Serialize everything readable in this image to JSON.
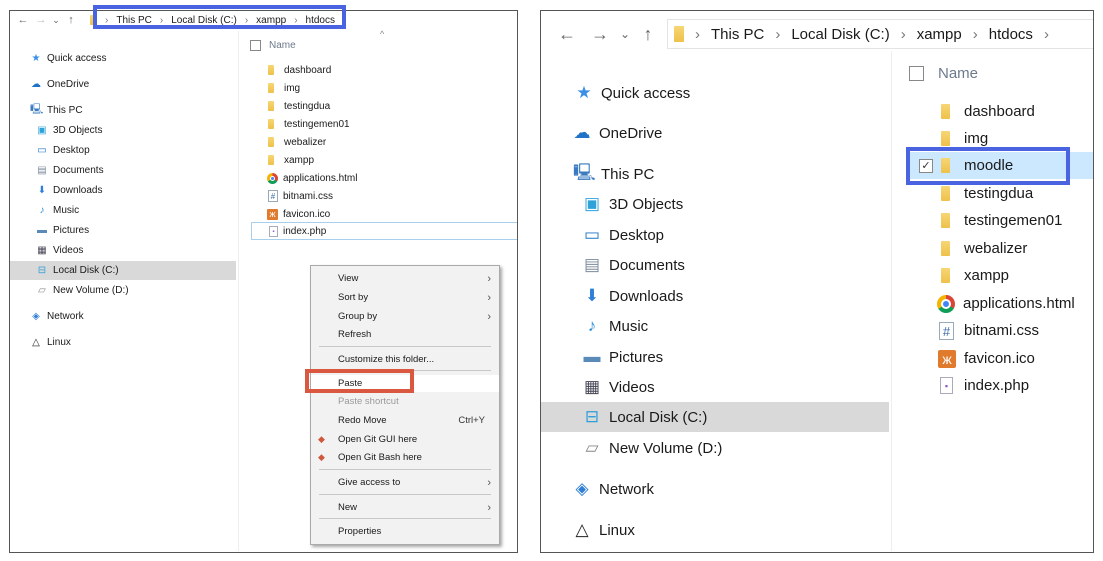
{
  "left_window": {
    "nav": {
      "back": "←",
      "forward": "→",
      "recent": "⌄",
      "up": "↑"
    },
    "breadcrumb": [
      "This PC",
      "Local Disk (C:)",
      "xampp",
      "htdocs"
    ],
    "sidebar": [
      {
        "label": "Quick access",
        "icon": "star-icon",
        "glyph": "★"
      },
      {
        "label": "OneDrive",
        "icon": "cloud-icon",
        "glyph": "☁"
      },
      {
        "label": "This PC",
        "icon": "computer-icon",
        "glyph": "🖳"
      },
      {
        "label": "3D Objects",
        "icon": "cube-icon",
        "glyph": "▣"
      },
      {
        "label": "Desktop",
        "icon": "desktop-icon",
        "glyph": "▭"
      },
      {
        "label": "Documents",
        "icon": "document-icon",
        "glyph": "▤"
      },
      {
        "label": "Downloads",
        "icon": "download-icon",
        "glyph": "⬇"
      },
      {
        "label": "Music",
        "icon": "music-icon",
        "glyph": "♪"
      },
      {
        "label": "Pictures",
        "icon": "pictures-icon",
        "glyph": "▬"
      },
      {
        "label": "Videos",
        "icon": "videos-icon",
        "glyph": "▦"
      },
      {
        "label": "Local Disk (C:)",
        "icon": "drive-c-icon",
        "glyph": "⊟",
        "selected": true
      },
      {
        "label": "New Volume (D:)",
        "icon": "drive-d-icon",
        "glyph": "▱"
      },
      {
        "label": "Network",
        "icon": "network-icon",
        "glyph": "◈"
      },
      {
        "label": "Linux",
        "icon": "linux-icon",
        "glyph": "△"
      }
    ],
    "column_header": "Name",
    "sort_indicator": "^",
    "files": [
      {
        "name": "dashboard",
        "type": "folder"
      },
      {
        "name": "img",
        "type": "folder"
      },
      {
        "name": "testingdua",
        "type": "folder"
      },
      {
        "name": "testingemen01",
        "type": "folder"
      },
      {
        "name": "webalizer",
        "type": "folder"
      },
      {
        "name": "xampp",
        "type": "folder"
      },
      {
        "name": "applications.html",
        "type": "chrome"
      },
      {
        "name": "bitnami.css",
        "type": "css"
      },
      {
        "name": "favicon.ico",
        "type": "ico"
      },
      {
        "name": "index.php",
        "type": "php",
        "focused": true
      }
    ],
    "context_menu": [
      {
        "label": "View",
        "submenu": true
      },
      {
        "label": "Sort by",
        "submenu": true
      },
      {
        "label": "Group by",
        "submenu": true
      },
      {
        "label": "Refresh"
      },
      {
        "separator": true
      },
      {
        "label": "Customize this folder..."
      },
      {
        "separator": true
      },
      {
        "label": "Paste",
        "highlighted": true
      },
      {
        "label": "Paste shortcut",
        "disabled": true
      },
      {
        "label": "Redo Move",
        "shortcut": "Ctrl+Y"
      },
      {
        "label": "Open Git GUI here",
        "icon": "git-icon"
      },
      {
        "label": "Open Git Bash here",
        "icon": "git-icon"
      },
      {
        "separator": true
      },
      {
        "label": "Give access to",
        "submenu": true
      },
      {
        "separator": true
      },
      {
        "label": "New",
        "submenu": true
      },
      {
        "separator": true
      },
      {
        "label": "Properties"
      }
    ],
    "submenu_arrow": "›"
  },
  "right_window": {
    "nav": {
      "back": "←",
      "forward": "→",
      "recent": "⌄",
      "up": "↑"
    },
    "breadcrumb": [
      "This PC",
      "Local Disk (C:)",
      "xampp",
      "htdocs"
    ],
    "sidebar": [
      {
        "label": "Quick access",
        "icon": "star-icon",
        "glyph": "★"
      },
      {
        "label": "OneDrive",
        "icon": "cloud-icon",
        "glyph": "☁"
      },
      {
        "label": "This PC",
        "icon": "computer-icon",
        "glyph": "🖳"
      },
      {
        "label": "3D Objects",
        "icon": "cube-icon",
        "glyph": "▣"
      },
      {
        "label": "Desktop",
        "icon": "desktop-icon",
        "glyph": "▭"
      },
      {
        "label": "Documents",
        "icon": "document-icon",
        "glyph": "▤"
      },
      {
        "label": "Downloads",
        "icon": "download-icon",
        "glyph": "⬇"
      },
      {
        "label": "Music",
        "icon": "music-icon",
        "glyph": "♪"
      },
      {
        "label": "Pictures",
        "icon": "pictures-icon",
        "glyph": "▬"
      },
      {
        "label": "Videos",
        "icon": "videos-icon",
        "glyph": "▦"
      },
      {
        "label": "Local Disk (C:)",
        "icon": "drive-c-icon",
        "glyph": "⊟",
        "selected": true
      },
      {
        "label": "New Volume (D:)",
        "icon": "drive-d-icon",
        "glyph": "▱"
      },
      {
        "label": "Network",
        "icon": "network-icon",
        "glyph": "◈"
      },
      {
        "label": "Linux",
        "icon": "linux-icon",
        "glyph": "△"
      }
    ],
    "column_header": "Name",
    "files": [
      {
        "name": "dashboard",
        "type": "folder"
      },
      {
        "name": "img",
        "type": "folder"
      },
      {
        "name": "moodle",
        "type": "folder",
        "selected": true,
        "checked": "✓"
      },
      {
        "name": "testingdua",
        "type": "folder"
      },
      {
        "name": "testingemen01",
        "type": "folder"
      },
      {
        "name": "webalizer",
        "type": "folder"
      },
      {
        "name": "xampp",
        "type": "folder"
      },
      {
        "name": "applications.html",
        "type": "chrome"
      },
      {
        "name": "bitnami.css",
        "type": "css"
      },
      {
        "name": "favicon.ico",
        "type": "ico"
      },
      {
        "name": "index.php",
        "type": "php"
      }
    ]
  },
  "colors": {
    "highlight_blue": "#4a63e0",
    "highlight_red": "#d9583f",
    "selection_gray": "#d9d9d9",
    "selection_blue": "#cce8ff"
  }
}
